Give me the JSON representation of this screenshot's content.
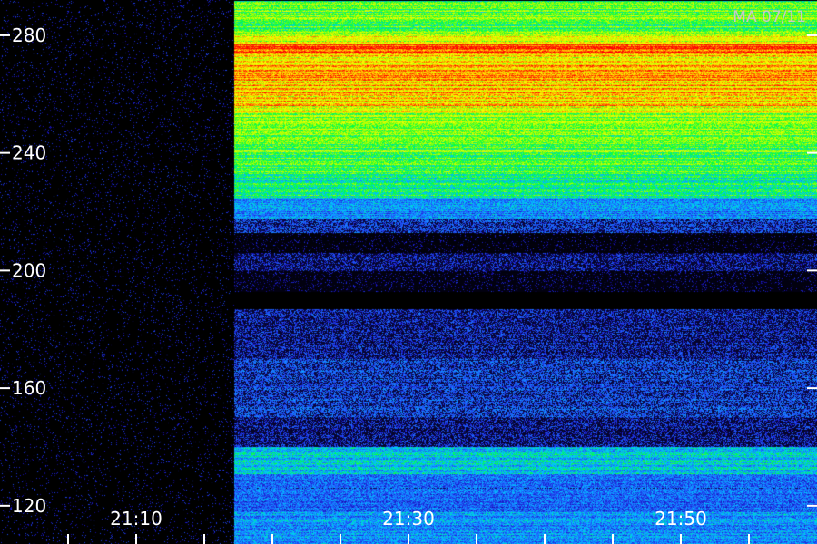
{
  "stamp": "MA 07/11",
  "chart_data": {
    "type": "heatmap",
    "title": "",
    "xlabel": "",
    "ylabel": "",
    "y_ticks": [
      280,
      240,
      200,
      160,
      120
    ],
    "y_range": [
      107,
      292
    ],
    "x_tick_labels": [
      "21:10",
      "21:30",
      "21:50"
    ],
    "x_label_minutes": [
      10,
      30,
      50
    ],
    "x_minor_tick_minutes": [
      5,
      10,
      15,
      20,
      25,
      30,
      35,
      40,
      45,
      50,
      55
    ],
    "x_range_minutes": [
      0,
      60
    ],
    "signal_start_minute": 17.2,
    "colormap": [
      "#000000",
      "#1a10c0",
      "#2060ff",
      "#00c8ff",
      "#00ff40",
      "#b0ff00",
      "#ffff00",
      "#ff8000",
      "#ff0000"
    ],
    "bands": [
      {
        "from": 281,
        "to": 292,
        "intensity": 0.55
      },
      {
        "from": 277,
        "to": 281,
        "intensity": 0.68
      },
      {
        "from": 274,
        "to": 277,
        "intensity": 0.92
      },
      {
        "from": 271,
        "to": 274,
        "intensity": 0.74
      },
      {
        "from": 260,
        "to": 271,
        "intensity": 0.8
      },
      {
        "from": 254,
        "to": 260,
        "intensity": 0.76
      },
      {
        "from": 240,
        "to": 254,
        "intensity": 0.58
      },
      {
        "from": 233,
        "to": 240,
        "intensity": 0.55
      },
      {
        "from": 225,
        "to": 233,
        "intensity": 0.46
      },
      {
        "from": 218,
        "to": 225,
        "intensity": 0.3
      },
      {
        "from": 213,
        "to": 218,
        "intensity": 0.16
      },
      {
        "from": 206,
        "to": 213,
        "intensity": 0.03
      },
      {
        "from": 200,
        "to": 206,
        "intensity": 0.12
      },
      {
        "from": 193,
        "to": 200,
        "intensity": 0.04
      },
      {
        "from": 187,
        "to": 193,
        "intensity": 0.0
      },
      {
        "from": 170,
        "to": 187,
        "intensity": 0.13
      },
      {
        "from": 150,
        "to": 170,
        "intensity": 0.17
      },
      {
        "from": 140,
        "to": 150,
        "intensity": 0.12
      },
      {
        "from": 131,
        "to": 140,
        "intensity": 0.38
      },
      {
        "from": 118,
        "to": 131,
        "intensity": 0.24
      },
      {
        "from": 107,
        "to": 118,
        "intensity": 0.3
      }
    ]
  }
}
